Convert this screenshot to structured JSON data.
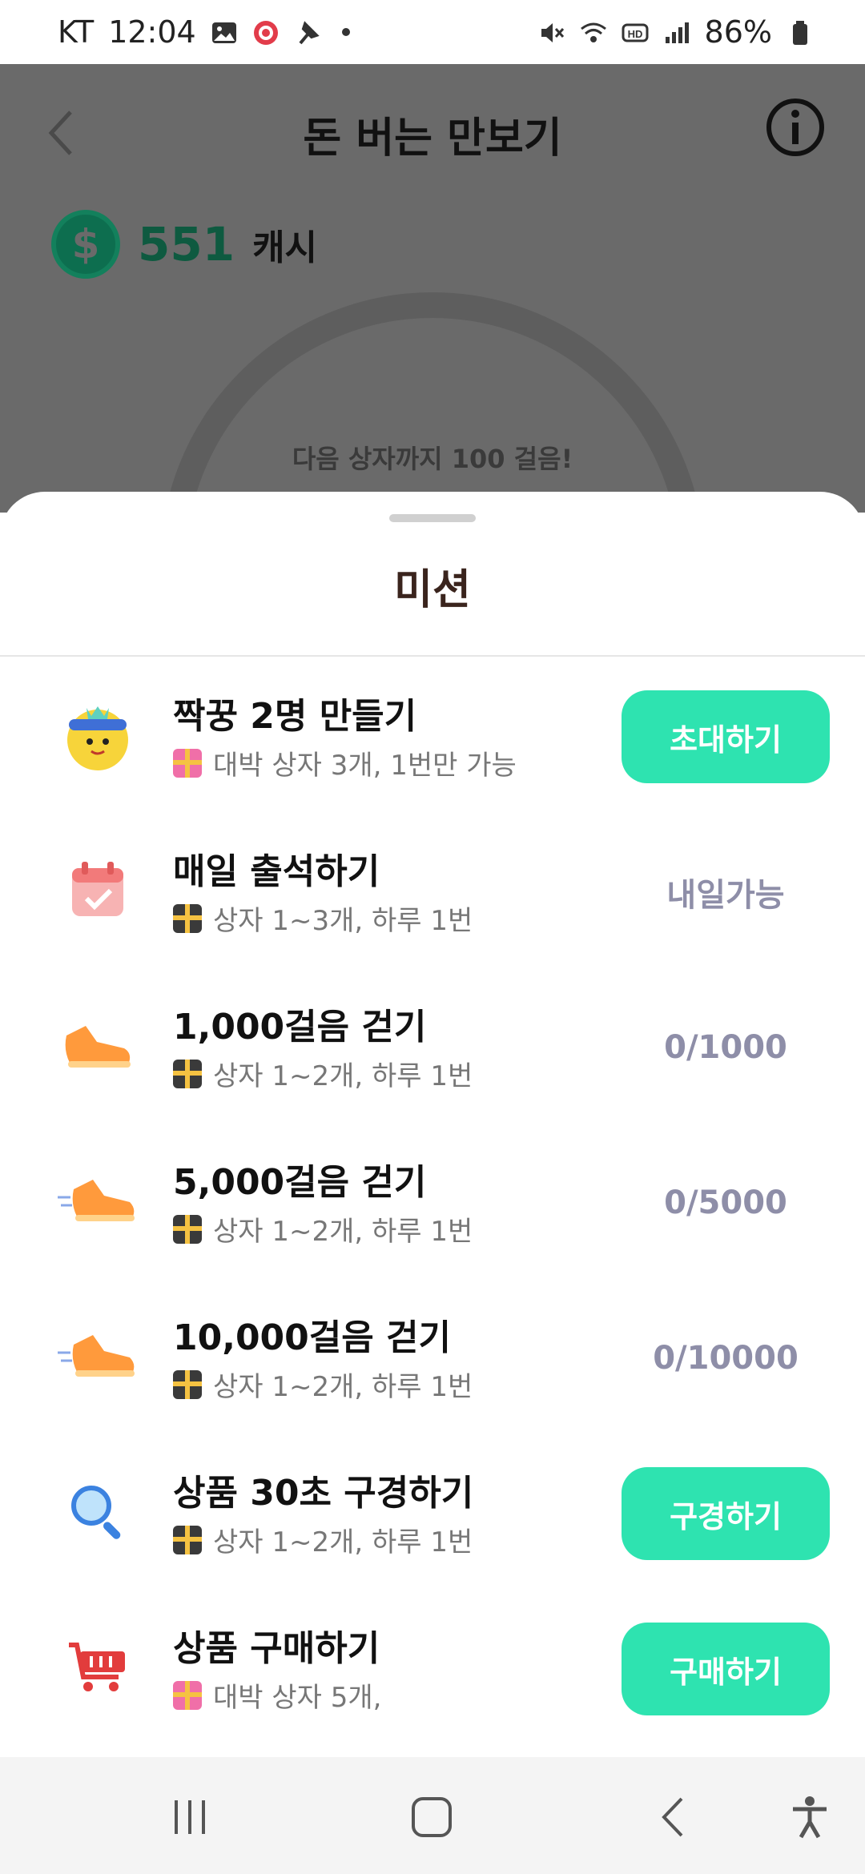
{
  "status_bar": {
    "carrier": "KT",
    "time": "12:04",
    "battery": "86%",
    "left_icons": [
      "image-icon",
      "app-notification-icon",
      "pin-icon"
    ],
    "right_icons": [
      "mute-icon",
      "wifi-icon",
      "hd-icon",
      "signal-icon",
      "battery-icon"
    ]
  },
  "header": {
    "title": "돈 버는 만보기",
    "back_icon": "chevron-left-icon",
    "info_icon": "info-icon"
  },
  "cash": {
    "symbol": "$",
    "amount": "551",
    "unit": "캐시"
  },
  "progress": {
    "next_box_text": "다음 상자까지 100 걸음!"
  },
  "sheet": {
    "title": "미션",
    "missions": [
      {
        "title": "짝꿍 2명 만들기",
        "reward": "대박 상자 3개, 1번만 가능",
        "action": "초대하기",
        "status": null,
        "icon": "friend-character-icon",
        "gift": "pink"
      },
      {
        "title": "매일 출석하기",
        "reward": "상자 1~3개, 하루 1번",
        "action": null,
        "status": "내일가능",
        "icon": "calendar-icon",
        "gift": "dark"
      },
      {
        "title": "1,000걸음 걷기",
        "reward": "상자 1~2개, 하루 1번",
        "action": null,
        "status": "0/1000",
        "icon": "sneaker-icon",
        "gift": "dark"
      },
      {
        "title": "5,000걸음 걷기",
        "reward": "상자 1~2개, 하루 1번",
        "action": null,
        "status": "0/5000",
        "icon": "running-sneaker-icon",
        "gift": "dark"
      },
      {
        "title": "10,000걸음 걷기",
        "reward": "상자 1~2개, 하루 1번",
        "action": null,
        "status": "0/10000",
        "icon": "running-sneaker-icon",
        "gift": "dark"
      },
      {
        "title": "상품 30초 구경하기",
        "reward": "상자 1~2개, 하루 1번",
        "action": "구경하기",
        "status": null,
        "icon": "magnifier-icon",
        "gift": "dark"
      },
      {
        "title": "상품 구매하기",
        "reward": "대박 상자 5개,",
        "action": "구매하기",
        "status": null,
        "icon": "shopping-cart-icon",
        "gift": "pink"
      }
    ]
  },
  "nav_bar": {
    "items": [
      "recent-apps-icon",
      "home-icon",
      "back-icon",
      "accessibility-icon"
    ]
  },
  "colors": {
    "accent": "#2ee3b0",
    "status_text": "#8e8ea8",
    "overlay": "#6a6a6a",
    "cash_green": "#0e5a40"
  }
}
